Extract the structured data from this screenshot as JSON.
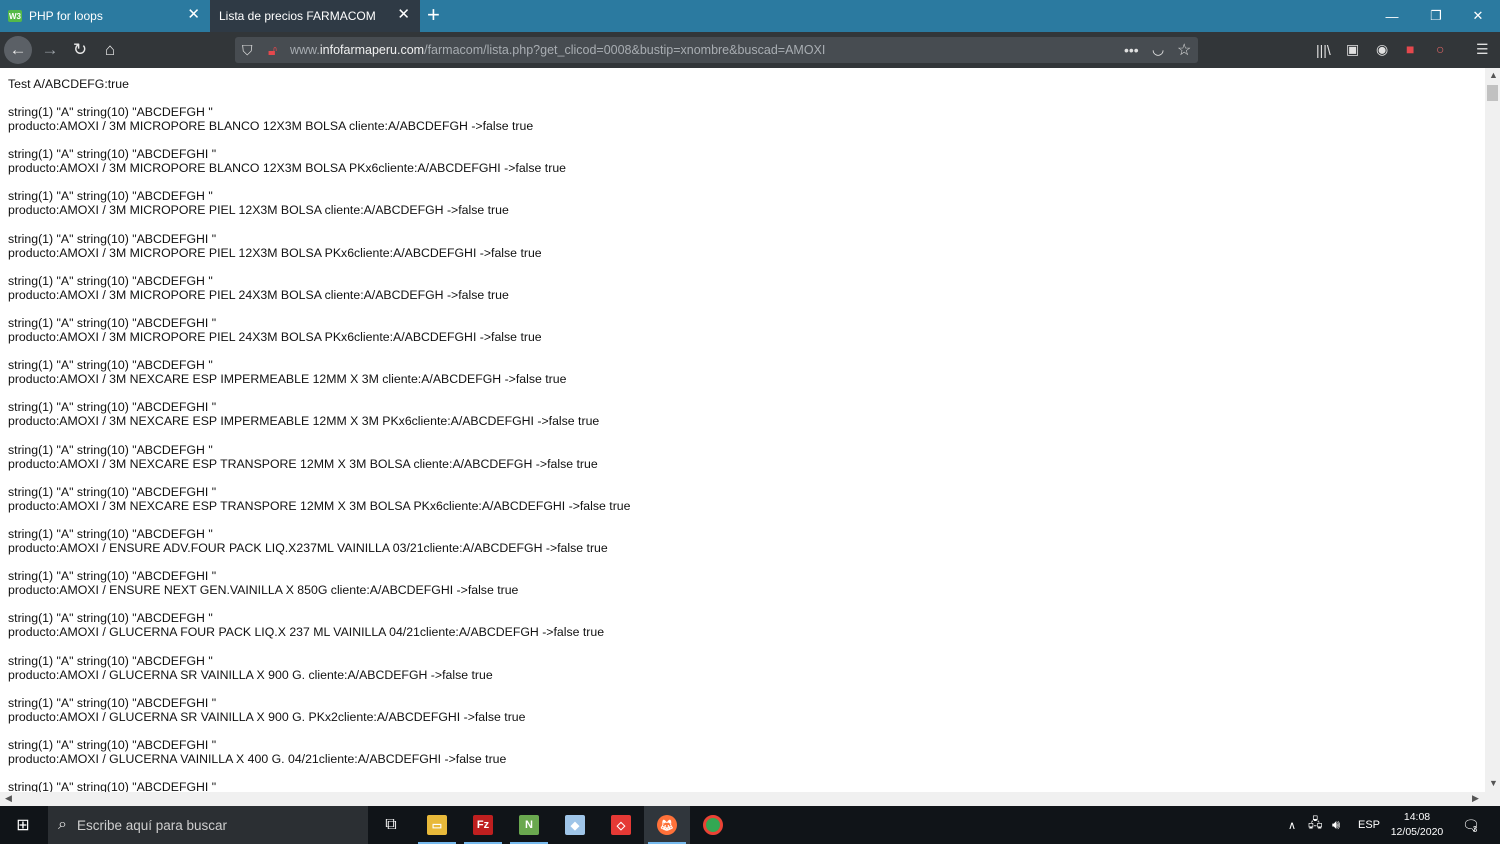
{
  "browser": {
    "tabs": [
      {
        "label": "PHP for loops",
        "favicon": "W3",
        "active": false
      },
      {
        "label": "Lista de precios FARMACOM",
        "active": true
      }
    ],
    "url_domain": "www.infofarmaperu.com",
    "url_path": "/farmacom/lista.php?get_clicod=0008&bustip=xnombre&buscad=AMOXI",
    "url_prefix": "www.",
    "url_host": "infofarmaperu.com"
  },
  "page": {
    "header": "Test A/ABCDEFG:true",
    "entries": [
      {
        "dump": "string(1) \"A\" string(10) \"ABCDEFGH \"",
        "product": "producto:AMOXI / 3M MICROPORE BLANCO 12X3M BOLSA cliente:A/ABCDEFGH ->false true"
      },
      {
        "dump": "string(1) \"A\" string(10) \"ABCDEFGHI \"",
        "product": "producto:AMOXI / 3M MICROPORE BLANCO 12X3M BOLSA PKx6cliente:A/ABCDEFGHI ->false true"
      },
      {
        "dump": "string(1) \"A\" string(10) \"ABCDEFGH \"",
        "product": "producto:AMOXI / 3M MICROPORE PIEL 12X3M BOLSA cliente:A/ABCDEFGH ->false true"
      },
      {
        "dump": "string(1) \"A\" string(10) \"ABCDEFGHI \"",
        "product": "producto:AMOXI / 3M MICROPORE PIEL 12X3M BOLSA PKx6cliente:A/ABCDEFGHI ->false true"
      },
      {
        "dump": "string(1) \"A\" string(10) \"ABCDEFGH \"",
        "product": "producto:AMOXI / 3M MICROPORE PIEL 24X3M BOLSA cliente:A/ABCDEFGH ->false true"
      },
      {
        "dump": "string(1) \"A\" string(10) \"ABCDEFGHI \"",
        "product": "producto:AMOXI / 3M MICROPORE PIEL 24X3M BOLSA PKx6cliente:A/ABCDEFGHI ->false true"
      },
      {
        "dump": "string(1) \"A\" string(10) \"ABCDEFGH \"",
        "product": "producto:AMOXI / 3M NEXCARE ESP IMPERMEABLE 12MM X 3M cliente:A/ABCDEFGH ->false true"
      },
      {
        "dump": "string(1) \"A\" string(10) \"ABCDEFGHI \"",
        "product": "producto:AMOXI / 3M NEXCARE ESP IMPERMEABLE 12MM X 3M PKx6cliente:A/ABCDEFGHI ->false true"
      },
      {
        "dump": "string(1) \"A\" string(10) \"ABCDEFGH \"",
        "product": "producto:AMOXI / 3M NEXCARE ESP TRANSPORE 12MM X 3M BOLSA cliente:A/ABCDEFGH ->false true"
      },
      {
        "dump": "string(1) \"A\" string(10) \"ABCDEFGHI \"",
        "product": "producto:AMOXI / 3M NEXCARE ESP TRANSPORE 12MM X 3M BOLSA PKx6cliente:A/ABCDEFGHI ->false true"
      },
      {
        "dump": "string(1) \"A\" string(10) \"ABCDEFGH \"",
        "product": "producto:AMOXI / ENSURE ADV.FOUR PACK LIQ.X237ML VAINILLA 03/21cliente:A/ABCDEFGH ->false true"
      },
      {
        "dump": "string(1) \"A\" string(10) \"ABCDEFGHI \"",
        "product": "producto:AMOXI / ENSURE NEXT GEN.VAINILLA X 850G cliente:A/ABCDEFGHI ->false true"
      },
      {
        "dump": "string(1) \"A\" string(10) \"ABCDEFGH \"",
        "product": "producto:AMOXI / GLUCERNA FOUR PACK LIQ.X 237 ML VAINILLA 04/21cliente:A/ABCDEFGH ->false true"
      },
      {
        "dump": "string(1) \"A\" string(10) \"ABCDEFGH \"",
        "product": "producto:AMOXI / GLUCERNA SR VAINILLA X 900 G. cliente:A/ABCDEFGH ->false true"
      },
      {
        "dump": "string(1) \"A\" string(10) \"ABCDEFGHI \"",
        "product": "producto:AMOXI / GLUCERNA SR VAINILLA X 900 G. PKx2cliente:A/ABCDEFGHI ->false true"
      },
      {
        "dump": "string(1) \"A\" string(10) \"ABCDEFGHI \"",
        "product": "producto:AMOXI / GLUCERNA VAINILLA X 400 G. 04/21cliente:A/ABCDEFGHI ->false true"
      },
      {
        "dump": "string(1) \"A\" string(10) \"ABCDEFGHI \"",
        "product": ""
      }
    ]
  },
  "taskbar": {
    "search_placeholder": "Escribe aquí para buscar",
    "language": "ESP",
    "time": "14:08",
    "date": "12/05/2020",
    "notification_count": "3"
  },
  "colors": {
    "tabbar": "#2b7aa0",
    "active_tab": "#2f3a45",
    "navbar": "#323639",
    "taskbar": "#101418"
  }
}
